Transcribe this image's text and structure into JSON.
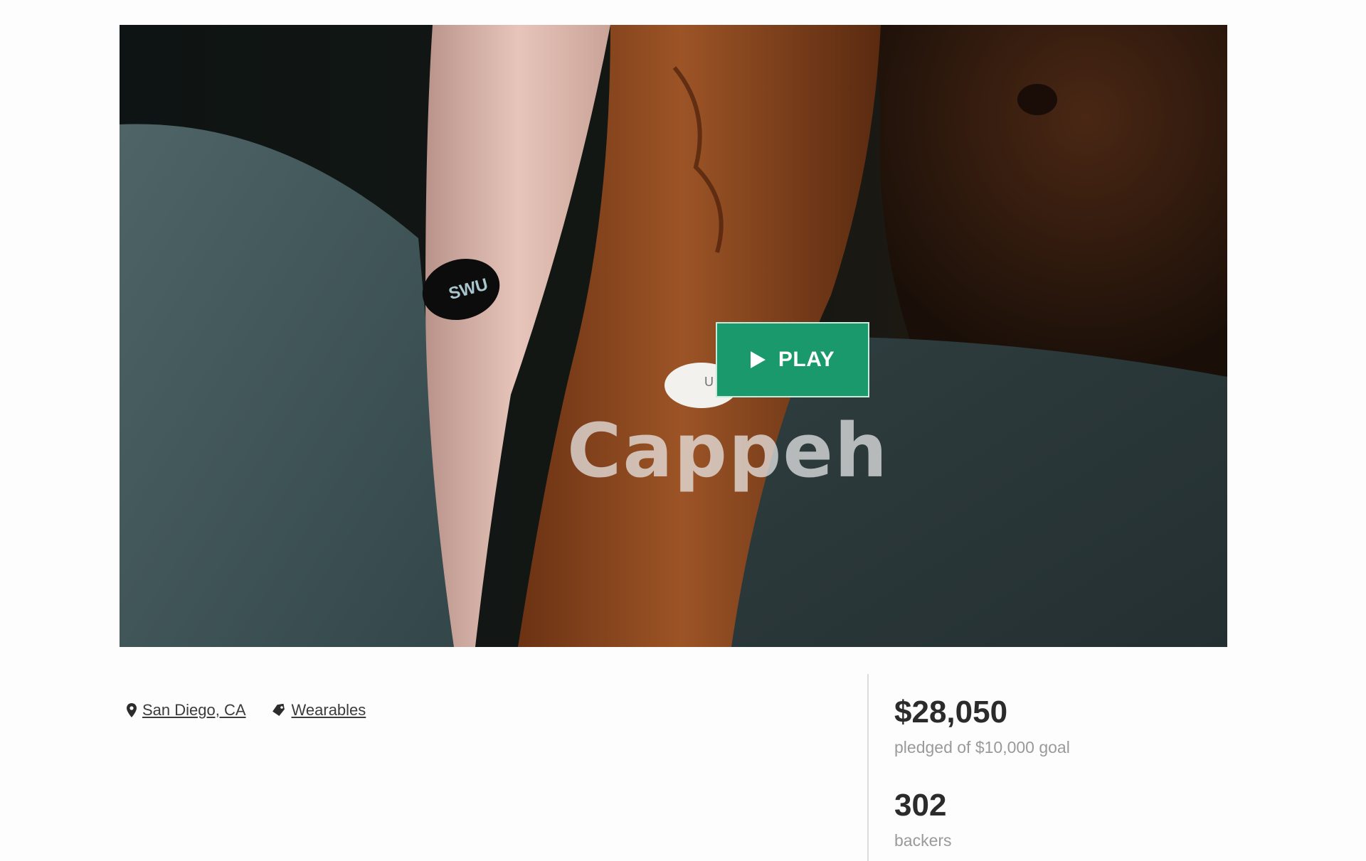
{
  "video": {
    "play_label": "PLAY",
    "device_text": "SWU",
    "device_text_partial": "U",
    "watermark": "Cappeh"
  },
  "project": {
    "location": "San Diego, CA",
    "category": "Wearables"
  },
  "funding": {
    "pledged": "$28,050",
    "pledged_caption": "pledged of $10,000 goal",
    "backers": "302",
    "backers_caption": "backers"
  },
  "colors": {
    "accent": "#1a9a6c",
    "text_dark": "#2b2b2b",
    "text_muted": "#9a9a9a"
  },
  "icons": {
    "location": "map-pin-icon",
    "category": "tag-icon",
    "play": "play-icon"
  }
}
